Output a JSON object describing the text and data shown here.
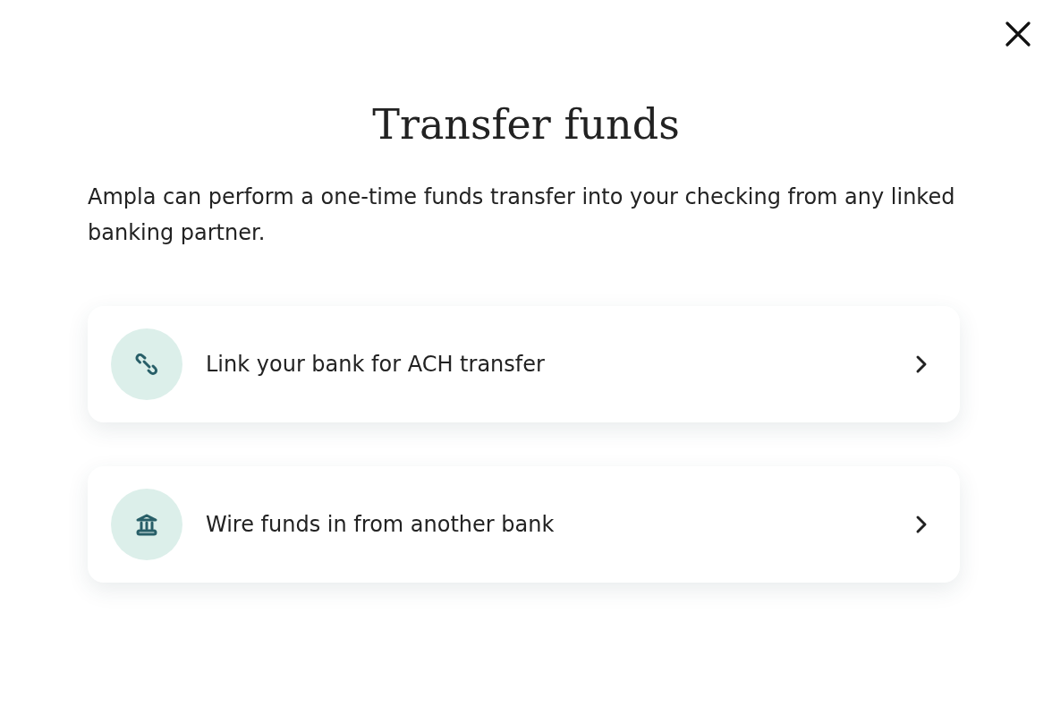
{
  "title": "Transfer funds",
  "description": "Ampla can perform a one-time funds transfer into your checking from any linked banking partner.",
  "options": [
    {
      "kind": "link",
      "label": "Link your bank for ACH transfer"
    },
    {
      "kind": "bank",
      "label": "Wire funds in from another bank"
    }
  ]
}
